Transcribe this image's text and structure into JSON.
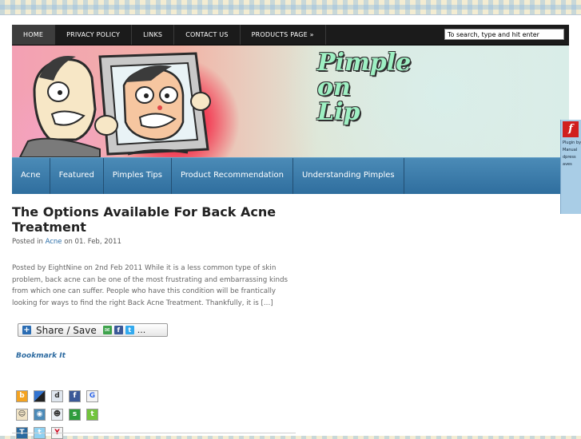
{
  "nav": {
    "items": [
      "HOME",
      "PRIVACY POLICY",
      "LINKS",
      "CONTACT US",
      "PRODUCTS PAGE »"
    ],
    "search_value": "To search, type and hit enter"
  },
  "header": {
    "title_lines": [
      "Pimple",
      "on",
      "Lip"
    ]
  },
  "categories": [
    "Acne",
    "Featured",
    "Pimples Tips",
    "Product Recommendation",
    "Understanding Pimples"
  ],
  "post": {
    "title": "The Options Available For Back Acne Treatment",
    "meta_prefix": "Posted in",
    "meta_category": "Acne",
    "meta_on": "on",
    "meta_date": "01. Feb, 2011",
    "excerpt": "Posted by EightNine on 2nd Feb 2011 While it is a less common type of skin problem, back acne can be one of the most frustrating and embarrassing kinds from which one can suffer. People who have this condition will be frantically looking for ways to find the right Back Acne Treatment. Thankfully, it is [...]"
  },
  "share": {
    "label": "Share / Save",
    "more": "..."
  },
  "bookmark": {
    "label": "Bookmark It",
    "rows": [
      [
        "blinklist-icon",
        "delicious-icon",
        "digg-icon",
        "facebook-icon",
        "google-icon"
      ],
      [
        "myspace-icon",
        "stumble-icon",
        "reddit-icon",
        "stumbleupon-icon",
        "technorati-plus-icon"
      ],
      [
        "technorati-icon",
        "twitter-icon",
        "yahoo-icon"
      ]
    ]
  },
  "flash_widget": {
    "lines": [
      "Plugin by",
      "Manual",
      "dpress",
      "aves"
    ]
  },
  "colors": {
    "topnav_bg": "#1b1b1b",
    "catnav_bg": "#3a7aa8",
    "link": "#2a6ea8",
    "title_text": "#9ef0c3"
  }
}
